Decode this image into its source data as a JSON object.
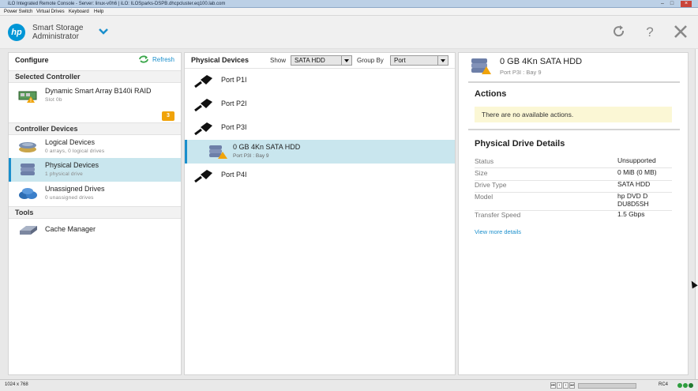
{
  "window": {
    "title": "iLO Integrated Remote Console - Server: linux-v0h6 | iLO: ILOSparks-DSPB.dhcpcluster.eq100.lab.com"
  },
  "menubar": [
    "Power Switch",
    "Virtual Drives",
    "Keyboard",
    "Help"
  ],
  "header": {
    "logo": "hp",
    "title_line1": "Smart Storage",
    "title_line2": "Administrator",
    "icons": [
      "refresh-icon",
      "help-icon",
      "close-icon"
    ]
  },
  "left": {
    "title": "Configure",
    "refresh_label": "Refresh",
    "sections": {
      "selected_controller": "Selected Controller",
      "controller_devices": "Controller Devices",
      "tools": "Tools"
    },
    "controller": {
      "name": "Dynamic Smart Array B140i RAID",
      "slot": "Slot 0b",
      "alert_count": "3"
    },
    "devices": [
      {
        "label": "Logical Devices",
        "sub": "0 arrays, 0 logical drives"
      },
      {
        "label": "Physical Devices",
        "sub": "1 physical drive"
      },
      {
        "label": "Unassigned Drives",
        "sub": "0 unassigned drives"
      }
    ],
    "tools": [
      {
        "label": "Cache Manager"
      }
    ]
  },
  "middle": {
    "title": "Physical Devices",
    "show_label": "Show",
    "show_value": "SATA HDD",
    "groupby_label": "Group By",
    "groupby_value": "Port",
    "rows": [
      {
        "label": "Port P1I"
      },
      {
        "label": "Port P2I"
      },
      {
        "label": "Port P3I"
      },
      {
        "label": "0 GB 4Kn SATA HDD",
        "sub": "Port P3I : Bay 9"
      },
      {
        "label": "Port P4I"
      }
    ]
  },
  "right": {
    "title": "0 GB 4Kn SATA HDD",
    "subtitle": "Port P3I : Bay 9",
    "actions_heading": "Actions",
    "no_actions": "There are no available actions.",
    "details_heading": "Physical Drive Details",
    "details": [
      {
        "key": "Status",
        "value": "Unsupported"
      },
      {
        "key": "Size",
        "value": "0 MiB (0 MB)"
      },
      {
        "key": "Drive Type",
        "value": "SATA HDD"
      },
      {
        "key": "Model",
        "value": "hp DVD D\nDU8D5SH"
      },
      {
        "key": "Transfer Speed",
        "value": "1.5 Gbps"
      }
    ],
    "more_link": "View more details"
  },
  "statusbar": {
    "resolution": "1024 x 768",
    "encryption": "RC4"
  },
  "colors": {
    "accent": "#1a8fcc",
    "selected_row": "#c9e6ee",
    "badge": "#f0a30a",
    "notice": "#fbf7d5"
  }
}
